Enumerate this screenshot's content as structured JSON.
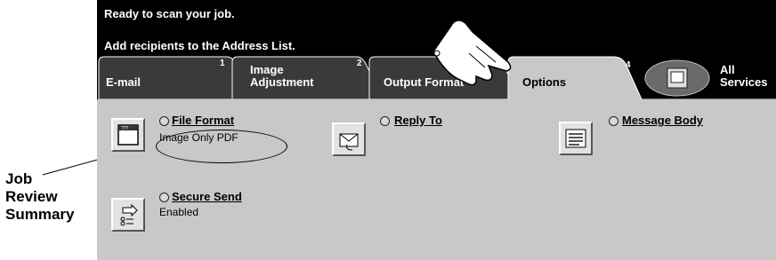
{
  "callout": {
    "line1": "Job",
    "line2": "Review",
    "line3": "Summary"
  },
  "messages": {
    "line1": "Ready to scan your job.",
    "line2": "Add recipients to the Address List."
  },
  "tabs": [
    {
      "label": "E-mail",
      "number": "1"
    },
    {
      "label_line1": "Image",
      "label_line2": "Adjustment",
      "number": "2"
    },
    {
      "label": "Output Format",
      "number": "3"
    },
    {
      "label": "Options",
      "number": "4"
    }
  ],
  "all_services": {
    "line1": "All",
    "line2": "Services"
  },
  "features": {
    "file_format": {
      "title": "File Format",
      "value": "Image Only PDF"
    },
    "reply_to": {
      "title": "Reply To"
    },
    "message_body": {
      "title": "Message Body"
    },
    "secure_send": {
      "title": "Secure Send",
      "value": "Enabled"
    }
  },
  "colors": {
    "screen_bg": "#000000",
    "panel_bg": "#c8c8c8",
    "active_tab": "#c8c8c8",
    "inactive_tab": "#3a3a3a"
  }
}
